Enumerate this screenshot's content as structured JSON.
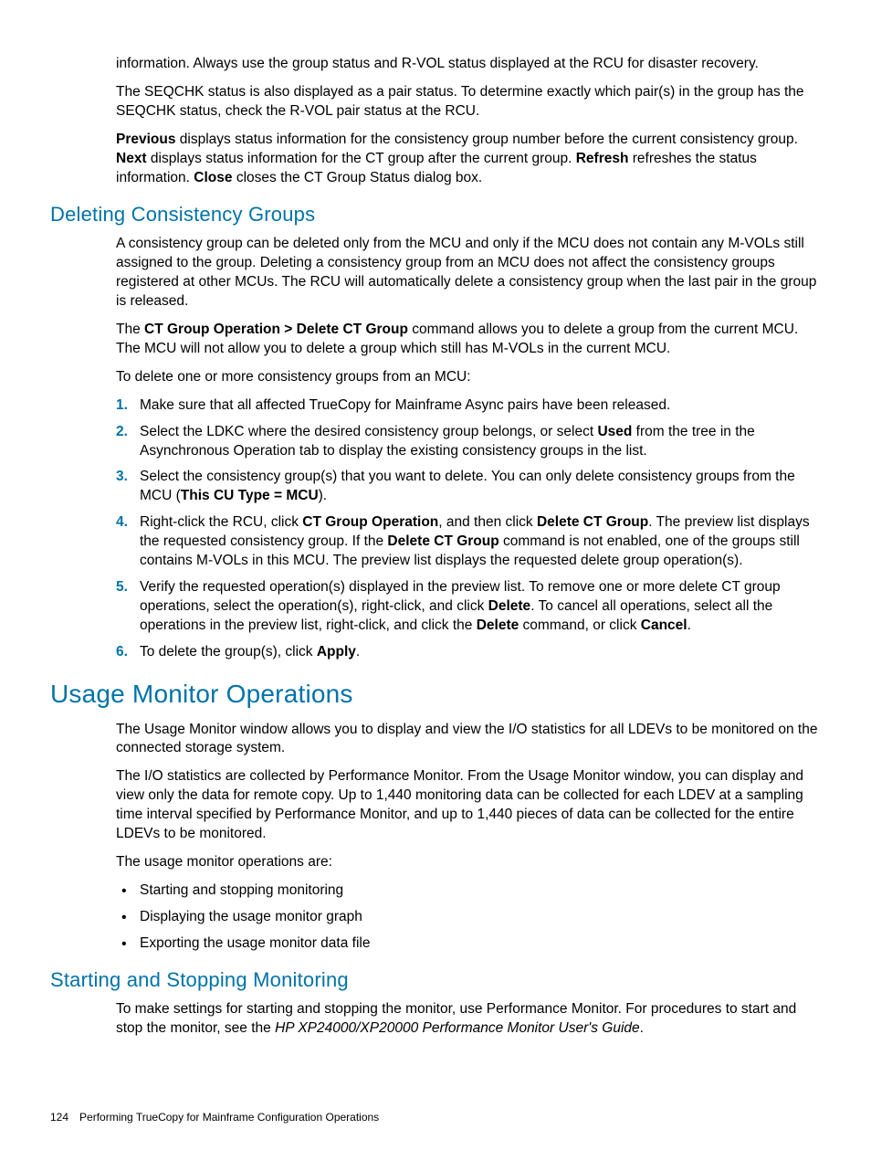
{
  "top": {
    "para1": "information. Always use the group status and R-VOL status displayed at the RCU for disaster recovery.",
    "para2": "The SEQCHK status is also displayed as a pair status. To determine exactly which pair(s) in the group has the SEQCHK status, check the R-VOL pair status at the RCU.",
    "para3_pre": "",
    "para3_b1": "Previous",
    "para3_mid1": " displays status information for the consistency group number before the current consistency group. ",
    "para3_b2": "Next",
    "para3_mid2": " displays status information for the CT group after the current group. ",
    "para3_b3": "Refresh",
    "para3_mid3": " refreshes the status information. ",
    "para3_b4": "Close",
    "para3_end": " closes the CT Group Status dialog box."
  },
  "delete": {
    "heading": "Deleting Consistency Groups",
    "para1": "A consistency group can be deleted only from the MCU and only if the MCU does not contain any M-VOLs still assigned to the group. Deleting a consistency group from an MCU does not affect the consistency groups registered at other MCUs. The RCU will automatically delete a consistency group when the last pair in the group is released.",
    "para2_pre": "The ",
    "para2_b1": "CT Group Operation > Delete CT Group",
    "para2_end": " command allows you to delete a group from the current MCU. The MCU will not allow you to delete a group which still has M-VOLs in the current MCU.",
    "para3": "To delete one or more consistency groups from an MCU:",
    "steps": [
      {
        "n": "1.",
        "text_a": "Make sure that all affected TrueCopy for Mainframe Async pairs have been released."
      },
      {
        "n": "2.",
        "text_a": "Select the LDKC where the desired consistency group belongs, or select ",
        "b1": "Used",
        "text_b": " from the tree in the Asynchronous Operation tab to display the existing consistency groups in the list."
      },
      {
        "n": "3.",
        "text_a": "Select the consistency group(s) that you want to delete. You can only delete consistency groups from the MCU (",
        "b1": "This CU Type = MCU",
        "text_b": ")."
      },
      {
        "n": "4.",
        "text_a": "Right-click the RCU, click ",
        "b1": "CT Group Operation",
        "text_b": ", and then click ",
        "b2": "Delete CT Group",
        "text_c": ". The preview list displays the requested consistency group. If the ",
        "b3": "Delete CT Group",
        "text_d": " command is not enabled, one of the groups still contains M-VOLs in this MCU. The preview list displays the requested delete group operation(s)."
      },
      {
        "n": "5.",
        "text_a": "Verify the requested operation(s) displayed in the preview list. To remove one or more delete CT group operations, select the operation(s), right-click, and click ",
        "b1": "Delete",
        "text_b": ". To cancel all operations, select all the operations in the preview list, right-click, and click the ",
        "b2": "Delete",
        "text_c": " command, or click ",
        "b3": "Cancel",
        "text_d": "."
      },
      {
        "n": "6.",
        "text_a": "To delete the group(s), click ",
        "b1": "Apply",
        "text_b": "."
      }
    ]
  },
  "usage": {
    "heading": "Usage Monitor Operations",
    "para1": "The Usage Monitor window allows you to display and view the I/O statistics for all LDEVs to be monitored on the connected storage system.",
    "para2": "The I/O statistics are collected by Performance Monitor. From the Usage Monitor window, you can display and view only the data for remote copy. Up to 1,440 monitoring data can be collected for each LDEV at a sampling time interval specified by Performance Monitor, and up to 1,440 pieces of data can be collected for the entire LDEVs to be monitored.",
    "para3": "The usage monitor operations are:",
    "bullets": [
      "Starting and stopping monitoring",
      "Displaying the usage monitor graph",
      "Exporting the usage monitor data file"
    ]
  },
  "startstop": {
    "heading": "Starting and Stopping Monitoring",
    "para1_a": "To make settings for starting and stopping the monitor, use Performance Monitor. For procedures to start and stop the monitor, see the ",
    "para1_i": "HP XP24000/XP20000 Performance Monitor User's Guide",
    "para1_b": "."
  },
  "footer": {
    "page": "124",
    "title": "Performing TrueCopy for Mainframe Configuration Operations"
  }
}
